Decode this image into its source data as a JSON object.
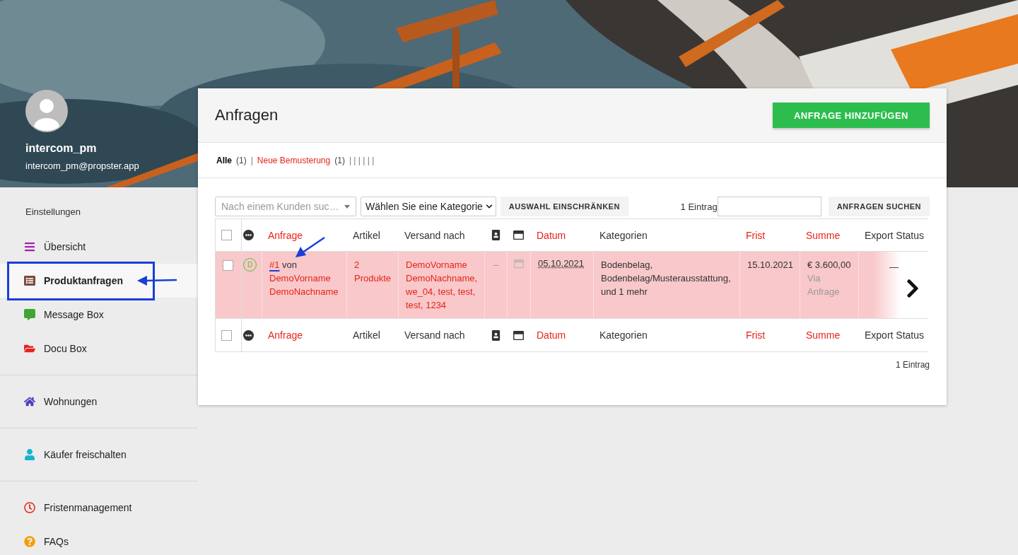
{
  "profile": {
    "name": "intercom_pm",
    "email": "intercom_pm@propster.app"
  },
  "sidebar": {
    "section_label": "Einstellungen",
    "groups": [
      {
        "items": [
          {
            "label": "Übersicht",
            "selected": false
          },
          {
            "label": "Produktanfragen",
            "selected": true
          },
          {
            "label": "Message Box",
            "selected": false
          },
          {
            "label": "Docu Box",
            "selected": false
          }
        ]
      },
      {
        "items": [
          {
            "label": "Wohnungen",
            "selected": false
          }
        ]
      },
      {
        "items": [
          {
            "label": "Käufer freischalten",
            "selected": false
          }
        ]
      },
      {
        "items": [
          {
            "label": "Fristenmanagement",
            "selected": false
          },
          {
            "label": "FAQs",
            "selected": false
          }
        ]
      }
    ]
  },
  "page": {
    "title": "Anfragen",
    "add_button": "ANFRAGE HINZUFÜGEN"
  },
  "filters": [
    {
      "label": "Alle",
      "count": "(1)",
      "selected": true
    },
    {
      "label": "Neue Bemusterung",
      "count": "(1)",
      "selected": false
    }
  ],
  "filter_separator": "|",
  "filters_trailing": "| | | | | |",
  "toolbar": {
    "customer_select": {
      "placeholder": "Nach einem Kunden suc…"
    },
    "category_select": {
      "value": "Wählen Sie eine Kategorie"
    },
    "restrict_button": "AUSWAHL EINSCHRÄNKEN",
    "count": "1 Eintrag",
    "search_button": "ANFRAGEN SUCHEN"
  },
  "table": {
    "header_columns": [
      {
        "kind": "checkbox",
        "checked": false
      },
      {
        "kind": "menu"
      },
      {
        "kind": "text",
        "label": "Anfrage",
        "sortable": true
      },
      {
        "kind": "text",
        "label": "Artikel",
        "sortable": false
      },
      {
        "kind": "text",
        "label": "Versand nach",
        "sortable": false
      },
      {
        "kind": "person"
      },
      {
        "kind": "window"
      },
      {
        "kind": "text",
        "label": "Datum",
        "sortable": true
      },
      {
        "kind": "text",
        "label": "Kategorien",
        "sortable": false
      },
      {
        "kind": "text",
        "label": "Frist",
        "sortable": true
      },
      {
        "kind": "text",
        "label": "Summe",
        "sortable": true
      },
      {
        "kind": "text",
        "label": "Export Status",
        "sortable": false
      }
    ],
    "rows": [
      {
        "highlighted": true,
        "checked": false,
        "status": "D",
        "number": "#1",
        "by": "von",
        "customer": "DemoVorname DemoNachname",
        "articles": "2 Produkte",
        "shipping": "DemoVorname DemoNachname, we_04, test, test, test, 1234",
        "contact": "–",
        "date": "05.10.2021",
        "categories": "Bodenbelag, Bodenbelag/Musterausstattung, und 1 mehr",
        "deadline": "15.10.2021",
        "sum": "€ 3.600,00",
        "sum_note": "Via Anfrage",
        "export": "—"
      }
    ],
    "footer_columns": [
      {
        "kind": "checkbox",
        "checked": false
      },
      {
        "kind": "menu"
      },
      {
        "kind": "text",
        "label": "Anfrage",
        "sortable": true
      },
      {
        "kind": "text",
        "label": "Artikel",
        "sortable": false
      },
      {
        "kind": "text",
        "label": "Versand nach",
        "sortable": false
      },
      {
        "kind": "person"
      },
      {
        "kind": "window"
      },
      {
        "kind": "text",
        "label": "Datum",
        "sortable": true
      },
      {
        "kind": "text",
        "label": "Kategorien",
        "sortable": false
      },
      {
        "kind": "text",
        "label": "Frist",
        "sortable": true
      },
      {
        "kind": "text",
        "label": "Summe",
        "sortable": true
      },
      {
        "kind": "text",
        "label": "Export Status",
        "sortable": false
      }
    ]
  },
  "footer_count": "1 Eintrag"
}
